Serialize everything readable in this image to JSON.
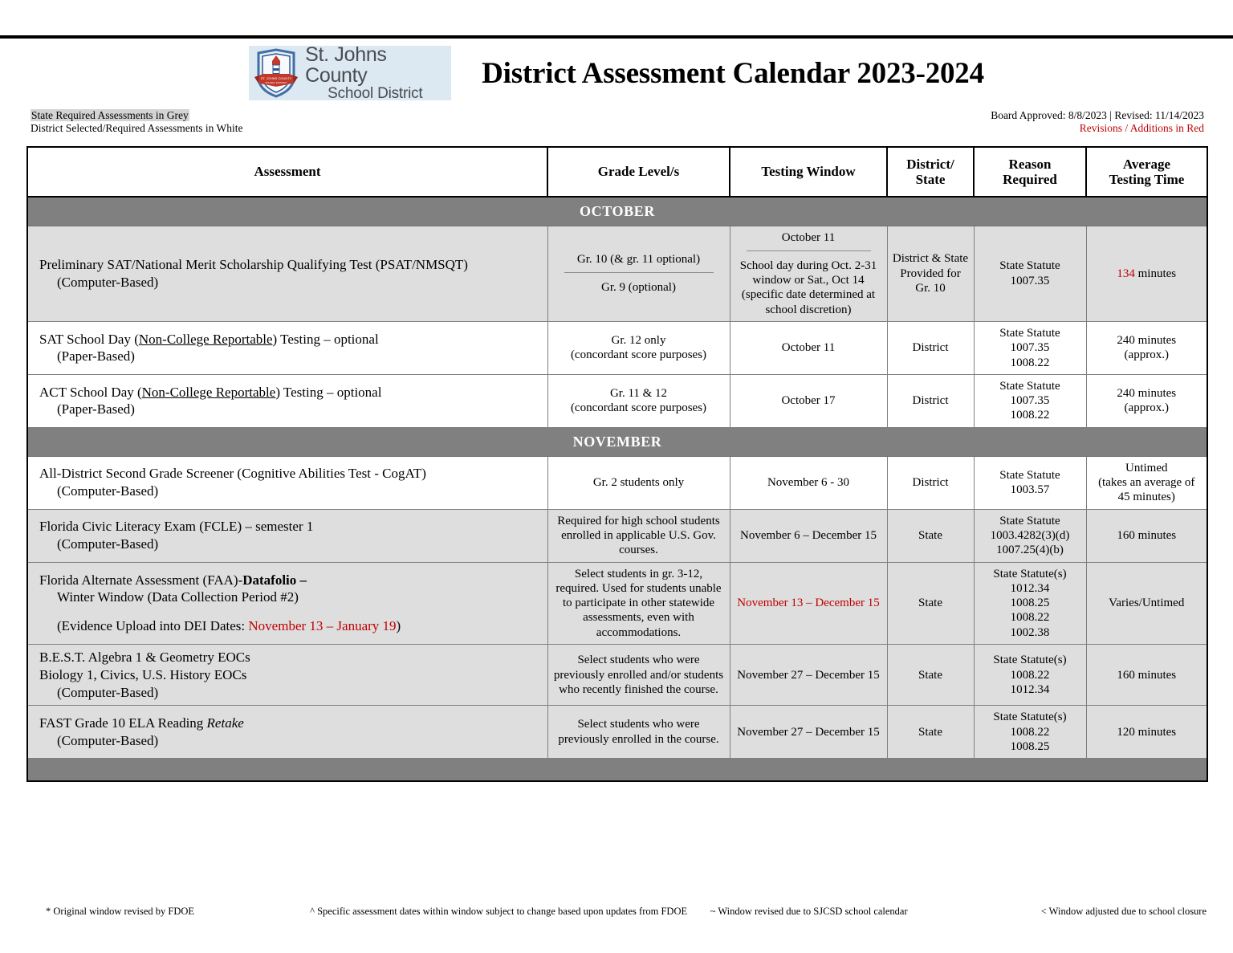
{
  "header": {
    "logo": {
      "line1": "St. Johns County",
      "line2": "School District",
      "crest_text": "ST. JOHNS COUNTY SCHOOL DISTRICT"
    },
    "title": "District Assessment Calendar 2023-2024"
  },
  "legend": {
    "state_line": "State Required Assessments in Grey",
    "district_line": "District Selected/Required Assessments in White"
  },
  "approval": {
    "line1": "Board Approved:  8/8/2023 | Revised: 11/14/2023",
    "line2": "Revisions / Additions in Red"
  },
  "columns": [
    "Assessment",
    "Grade Level/s",
    "Testing Window",
    "District/ State",
    "Reason Required",
    "Average Testing Time"
  ],
  "column_headers": {
    "assessment": "Assessment",
    "grade": "Grade Level/s",
    "window": "Testing Window",
    "ds_line1": "District/",
    "ds_line2": "State",
    "reason_line1": "Reason",
    "reason_line2": "Required",
    "time_line1": "Average",
    "time_line2": "Testing Time"
  },
  "months": {
    "october": "OCTOBER",
    "november": "NOVEMBER"
  },
  "rows": {
    "psat": {
      "shading": "state",
      "assessment_line1": "Preliminary SAT/National Merit Scholarship Qualifying Test (PSAT/NMSQT)",
      "assessment_line2": "(Computer-Based)",
      "grade_top": "Gr. 10 (& gr. 11 optional)",
      "grade_bottom": "Gr. 9 (optional)",
      "window_top": "October 11",
      "window_bottom": "School day during Oct. 2-31 window or Sat., Oct 14 (specific date determined at school discretion)",
      "district_state": "District & State Provided for Gr. 10",
      "reason": "State Statute 1007.35",
      "time_value": "134",
      "time_unit": " minutes"
    },
    "sat_school_day": {
      "shading": "district",
      "assessment_pre": "SAT School Day (",
      "assessment_underline": "Non-College Reportable",
      "assessment_post": ") Testing – optional",
      "assessment_line2": "(Paper-Based)",
      "grade_line1": "Gr. 12 only",
      "grade_line2": "(concordant score purposes)",
      "window": "October 11",
      "district_state": "District",
      "reason_line1": "State Statute",
      "reason_line2": "1007.35",
      "reason_line3": "1008.22",
      "time_line1": "240 minutes",
      "time_line2": "(approx.)"
    },
    "act_school_day": {
      "shading": "district",
      "assessment_pre": "ACT School Day (",
      "assessment_underline": "Non-College Reportable",
      "assessment_post": ") Testing – optional",
      "assessment_line2": "(Paper-Based)",
      "grade_line1": "Gr. 11 & 12",
      "grade_line2": "(concordant score purposes)",
      "window": "October 17",
      "district_state": "District",
      "reason_line1": "State Statute",
      "reason_line2": "1007.35",
      "reason_line3": "1008.22",
      "time_line1": "240 minutes",
      "time_line2": "(approx.)"
    },
    "cogat": {
      "shading": "district",
      "assessment_line1": "All-District Second Grade Screener (Cognitive Abilities Test - CogAT)",
      "assessment_line2": "(Computer-Based)",
      "grade": "Gr. 2 students only",
      "window": "November 6 - 30",
      "district_state": "District",
      "reason_line1": "State Statute",
      "reason_line2": "1003.57",
      "time_line1": "Untimed",
      "time_line2": "(takes an average of",
      "time_line3": "45 minutes)"
    },
    "fcle": {
      "shading": "state",
      "assessment_line1": "Florida Civic Literacy Exam (FCLE) – semester 1",
      "assessment_line2": "(Computer-Based)",
      "grade": "Required for high school students enrolled in applicable U.S. Gov. courses.",
      "window": "November 6 – December 15",
      "district_state": "State",
      "reason_line1": "State Statute",
      "reason_line2": "1003.4282(3)(d)",
      "reason_line3": "1007.25(4)(b)",
      "time": "160 minutes"
    },
    "faa_datafolio": {
      "shading": "state",
      "assessment_pre": "Florida Alternate Assessment (FAA)-",
      "assessment_bold": "Datafolio –",
      "assessment_line2": "Winter Window (Data Collection Period #2)",
      "assessment_line3_pre": "(Evidence Upload into DEI Dates:  ",
      "assessment_line3_red": "November 13 – January 19",
      "assessment_line3_post": ")",
      "grade": "Select students in gr. 3-12, required.  Used for students unable to participate in other statewide assessments, even with accommodations.",
      "window_red": "November 13 – December 15",
      "district_state": "State",
      "reason_line1": "State Statute(s)",
      "reason_line2": "1012.34",
      "reason_line3": "1008.25",
      "reason_line4": "1008.22",
      "reason_line5": "1002.38",
      "time": "Varies/Untimed"
    },
    "eocs": {
      "shading": "state",
      "assessment_line1": "B.E.S.T. Algebra 1 & Geometry EOCs",
      "assessment_line2": "Biology 1, Civics, U.S. History EOCs",
      "assessment_line3": "(Computer-Based)",
      "grade": "Select students who were previously enrolled and/or students who recently finished the course.",
      "window": "November 27 – December 15",
      "district_state": "State",
      "reason_line1": "State Statute(s)",
      "reason_line2": "1008.22",
      "reason_line3": "1012.34",
      "time": "160 minutes"
    },
    "fast_g10": {
      "shading": "state",
      "assessment_pre": "FAST Grade 10 ELA Reading ",
      "assessment_italic": "Retake",
      "assessment_line2": "(Computer-Based)",
      "grade": "Select students who were previously enrolled in the course.",
      "window": "November 27 – December 15",
      "district_state": "State",
      "reason_line1": "State Statute(s)",
      "reason_line2": "1008.22",
      "reason_line3": "1008.25",
      "time": "120 minutes"
    }
  },
  "footnotes": {
    "note1": "* Original window revised by FDOE",
    "note2": "^ Specific assessment dates within window subject to change based upon updates from FDOE",
    "note3": "~ Window revised due to SJCSD school calendar",
    "note4": "< Window adjusted due to school closure"
  },
  "colors": {
    "month_header_grey": "#808080",
    "state_row_grey": "#dedede",
    "district_row_white": "#ffffff",
    "accent_red": "#c00000",
    "logo_background": "#dce9f2"
  }
}
